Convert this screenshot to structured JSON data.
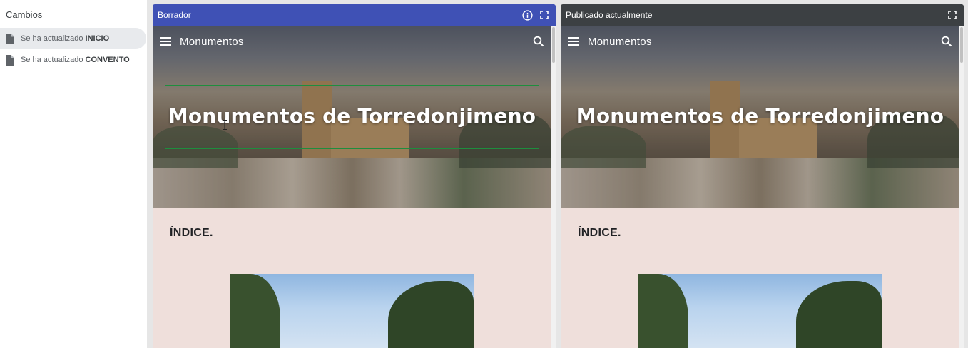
{
  "sidebar": {
    "title": "Cambios",
    "items": [
      {
        "prefix": "Se ha actualizado ",
        "page": "INICIO"
      },
      {
        "prefix": "Se ha actualizado ",
        "page": "CONVENTO"
      }
    ]
  },
  "draft_panel": {
    "title": "Borrador",
    "header_color": "#3f51b5"
  },
  "published_panel": {
    "title": "Publicado actualmente",
    "header_color": "#3c4043"
  },
  "site": {
    "nav_title": "Monumentos",
    "hero_title": "Monumentos de Torredonjimeno",
    "section_heading": "ÍNDICE."
  },
  "icons": {
    "info": "info-icon",
    "fullscreen": "fullscreen-icon",
    "menu": "hamburger-menu-icon",
    "search": "search-icon",
    "document": "document-icon"
  }
}
